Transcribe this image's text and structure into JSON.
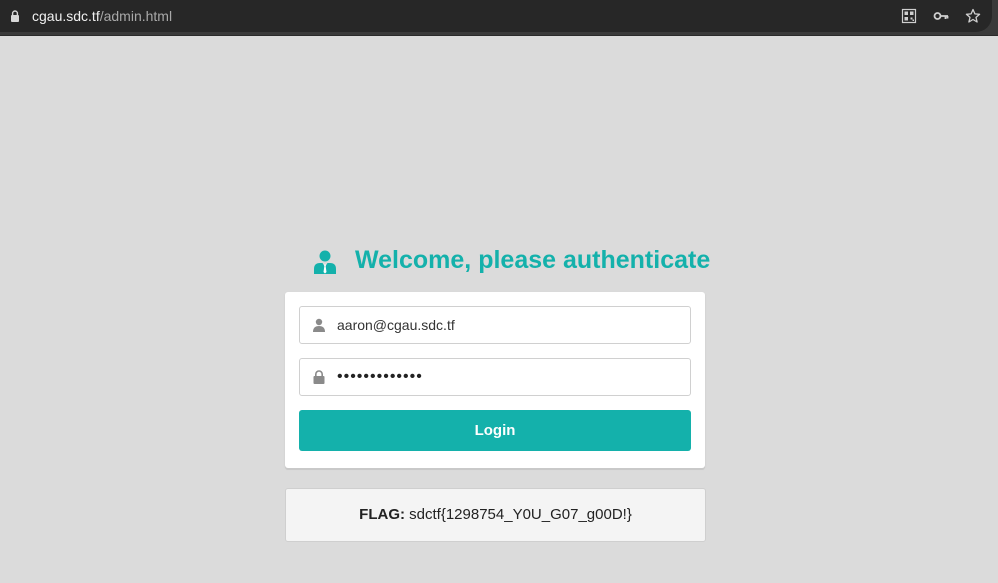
{
  "browser": {
    "url_host": "cgau.sdc.tf",
    "url_path": "/admin.html",
    "icons": [
      "lock-icon",
      "qr-code-icon",
      "key-icon",
      "star-icon"
    ]
  },
  "page": {
    "title": "Welcome, please authenticate",
    "email_value": "aaron@cgau.sdc.tf",
    "password_value": "•••••••••••••",
    "login_label": "Login",
    "flag_label": "FLAG:",
    "flag_value": "sdctf{1298754_Y0U_G07_g00D!}"
  },
  "colors": {
    "accent": "#14b1ab",
    "background": "#dbdbdb"
  }
}
